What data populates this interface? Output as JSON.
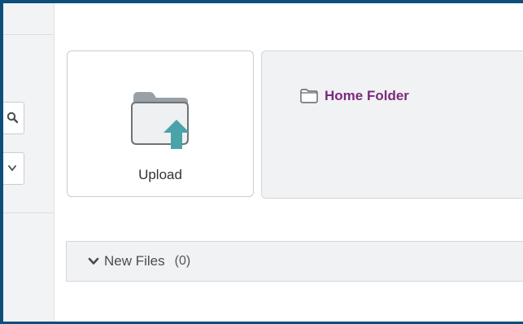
{
  "upload": {
    "label": "Upload",
    "icon": "folder-upload-icon"
  },
  "home_folder": {
    "label": "Home Folder",
    "icon": "folder-icon",
    "color": "#7b2a7e"
  },
  "new_files": {
    "label": "New Files",
    "count": "(0)",
    "icon": "chevron-down-icon"
  },
  "sidebar": {
    "search_icon": "search-icon",
    "dropdown_icon": "chevron-down-icon"
  },
  "colors": {
    "window_border": "#0d4f7a",
    "upload_arrow": "#4aa3a8",
    "folder_body": "#eef0f1",
    "folder_tab": "#9aa1a6"
  }
}
